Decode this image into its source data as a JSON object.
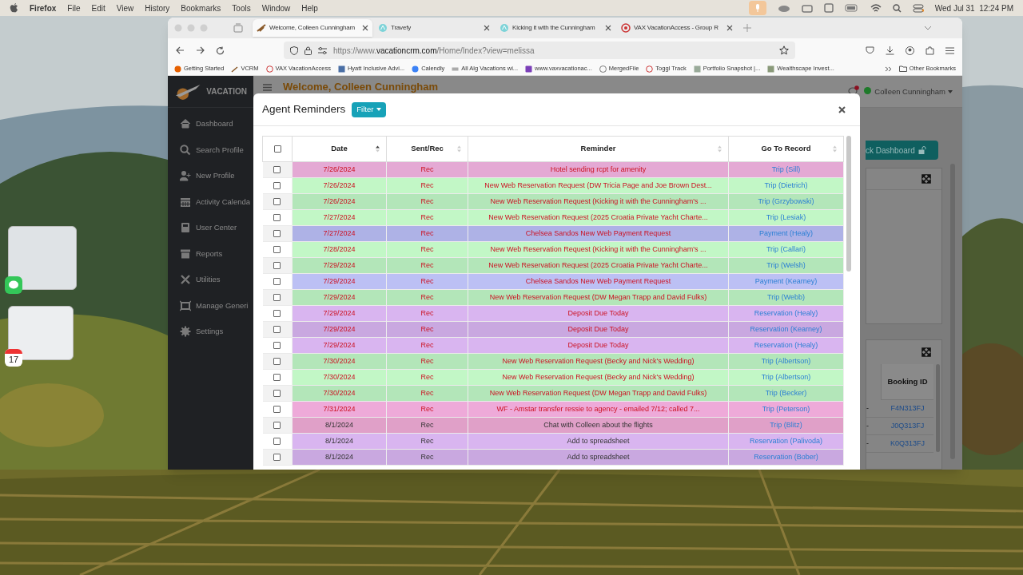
{
  "menu_bar": {
    "app": "Firefox",
    "menus": [
      "File",
      "Edit",
      "View",
      "History",
      "Bookmarks",
      "Tools",
      "Window",
      "Help"
    ],
    "clock": "Wed Jul 31  12:24 PM"
  },
  "desktop": {
    "calendar_day": "17"
  },
  "browser": {
    "tabs": [
      {
        "label": "Welcome, Colleen Cunningham",
        "selected": true
      },
      {
        "label": "Travefy",
        "selected": false
      },
      {
        "label": "Kicking it with the Cunningham",
        "selected": false
      },
      {
        "label": "VAX VacationAccess - Group R",
        "selected": false
      }
    ],
    "url": "https://www.**vacationcrm.com**/Home/Index?view=melissa",
    "bookmarks": [
      "Getting Started",
      "VCRM",
      "VAX VacationAccess",
      "Hyatt Inclusive Advi...",
      "Calendly",
      "All Alg Vacations wi...",
      "www.vaxvacationac...",
      "MergedFile",
      "Toggl Track",
      "Portfolio Snapshot |...",
      "Wealthscape Invest..."
    ],
    "other_bookmarks": "Other Bookmarks"
  },
  "app": {
    "logo": "VACATION",
    "sidebar": {
      "items": [
        {
          "label": "Dashboard",
          "kind": "home"
        },
        {
          "label": "Search Profile",
          "kind": "search"
        },
        {
          "label": "New Profile",
          "kind": "adduser"
        },
        {
          "label": "Activity Calenda",
          "kind": "calendar"
        },
        {
          "label": "User Center",
          "kind": "book"
        },
        {
          "label": "Reports",
          "kind": "archive"
        },
        {
          "label": "Utilities",
          "kind": "tools"
        },
        {
          "label": "Manage Generi",
          "kind": "frame"
        },
        {
          "label": "Settings",
          "kind": "gear"
        }
      ]
    },
    "header": {
      "title": "Welcome, Colleen Cunningham",
      "user": "Colleen Cunningham"
    },
    "dashboard_button": "ck Dashboard",
    "booking_table": {
      "columns": [
        "Booking ID"
      ],
      "rows": [
        {
          "column_1": "-",
          "booking_id": "F4N313FJ"
        },
        {
          "column_1": "-",
          "booking_id": "J0Q313FJ"
        },
        {
          "column_1": "-",
          "booking_id": "K0Q313FJ"
        }
      ]
    }
  },
  "modal": {
    "title": "Agent Reminders",
    "filter": "Filter",
    "table": {
      "select_all": {
        "checked": false
      },
      "columns": [
        {
          "label": "Date",
          "sorted": true
        },
        {
          "label": "Sent/Rec",
          "sorted": false
        },
        {
          "label": "Reminder",
          "sorted": false
        },
        {
          "label": "Go To Record",
          "sorted": false
        }
      ],
      "rows": [
        {
          "checked": false,
          "color": "#e4a9d4",
          "overdue": true,
          "date": "7/26/2024",
          "sent_rec": "Rec",
          "reminder": "Hotel sending rcpt for amenity",
          "record": "Trip (Sill)"
        },
        {
          "checked": false,
          "color": "#c2f7c6",
          "overdue": true,
          "date": "7/26/2024",
          "sent_rec": "Rec",
          "reminder": "New Web Reservation Request (DW Tricia Page and Joe Brown Dest...",
          "record": "Trip (Dietrich)"
        },
        {
          "checked": false,
          "color": "#b3e6b9",
          "overdue": true,
          "date": "7/26/2024",
          "sent_rec": "Rec",
          "reminder": "New Web Reservation Request (Kicking it with the Cunningham's ...",
          "record": "Trip (Grzybowski)"
        },
        {
          "checked": false,
          "color": "#c2f7c6",
          "overdue": true,
          "date": "7/27/2024",
          "sent_rec": "Rec",
          "reminder": "New Web Reservation Request (2025 Croatia Private Yacht Charte...",
          "record": "Trip (Lesiak)"
        },
        {
          "checked": false,
          "color": "#aeb2e6",
          "overdue": true,
          "date": "7/27/2024",
          "sent_rec": "Rec",
          "reminder": "Chelsea Sandos New Web Payment Request",
          "record": "Payment (Healy)"
        },
        {
          "checked": false,
          "color": "#c2f7c6",
          "overdue": true,
          "date": "7/28/2024",
          "sent_rec": "Rec",
          "reminder": "New Web Reservation Request (Kicking it with the Cunningham's ...",
          "record": "Trip (Callari)"
        },
        {
          "checked": false,
          "color": "#b3e6b9",
          "overdue": true,
          "date": "7/29/2024",
          "sent_rec": "Rec",
          "reminder": "New Web Reservation Request (2025 Croatia Private Yacht Charte...",
          "record": "Trip (Welsh)"
        },
        {
          "checked": false,
          "color": "#bcc0f4",
          "overdue": true,
          "date": "7/29/2024",
          "sent_rec": "Rec",
          "reminder": "Chelsea Sandos New Web Payment Request",
          "record": "Payment (Kearney)"
        },
        {
          "checked": false,
          "color": "#b3e6b9",
          "overdue": true,
          "date": "7/29/2024",
          "sent_rec": "Rec",
          "reminder": "New Web Reservation Request (DW Megan Trapp and David Fulks)",
          "record": "Trip (Webb)"
        },
        {
          "checked": false,
          "color": "#d9b5f0",
          "overdue": true,
          "date": "7/29/2024",
          "sent_rec": "Rec",
          "reminder": "Deposit Due Today",
          "record": "Reservation (Healy)"
        },
        {
          "checked": false,
          "color": "#c9a8e0",
          "overdue": true,
          "date": "7/29/2024",
          "sent_rec": "Rec",
          "reminder": "Deposit Due Today",
          "record": "Reservation (Kearney)"
        },
        {
          "checked": false,
          "color": "#d9b5f0",
          "overdue": true,
          "date": "7/29/2024",
          "sent_rec": "Rec",
          "reminder": "Deposit Due Today",
          "record": "Reservation (Healy)"
        },
        {
          "checked": false,
          "color": "#b3e6b9",
          "overdue": true,
          "date": "7/30/2024",
          "sent_rec": "Rec",
          "reminder": "New Web Reservation Request (Becky and Nick's Wedding)",
          "record": "Trip (Albertson)"
        },
        {
          "checked": false,
          "color": "#c2f7c6",
          "overdue": true,
          "date": "7/30/2024",
          "sent_rec": "Rec",
          "reminder": "New Web Reservation Request (Becky and Nick's Wedding)",
          "record": "Trip (Albertson)"
        },
        {
          "checked": false,
          "color": "#b3e6b9",
          "overdue": true,
          "date": "7/30/2024",
          "sent_rec": "Rec",
          "reminder": "New Web Reservation Request (DW Megan Trapp and David Fulks)",
          "record": "Trip (Becker)"
        },
        {
          "checked": false,
          "color": "#eeaad9",
          "overdue": true,
          "date": "7/31/2024",
          "sent_rec": "Rec",
          "reminder": "WF - Amstar transfer ressie to agency - emailed 7/12; called 7...",
          "record": "Trip (Peterson)"
        },
        {
          "checked": false,
          "color": "#e0a0c8",
          "overdue": false,
          "date": "8/1/2024",
          "sent_rec": "Rec",
          "reminder": "Chat with Colleen about the flights",
          "record": "Trip (Blitz)"
        },
        {
          "checked": false,
          "color": "#d9b5f0",
          "overdue": false,
          "date": "8/1/2024",
          "sent_rec": "Rec",
          "reminder": "Add to spreadsheet",
          "record": "Reservation (Palivoda)"
        },
        {
          "checked": false,
          "color": "#c9a8e0",
          "overdue": false,
          "date": "8/1/2024",
          "sent_rec": "Rec",
          "reminder": "Add to spreadsheet",
          "record": "Reservation (Bober)"
        }
      ]
    }
  }
}
